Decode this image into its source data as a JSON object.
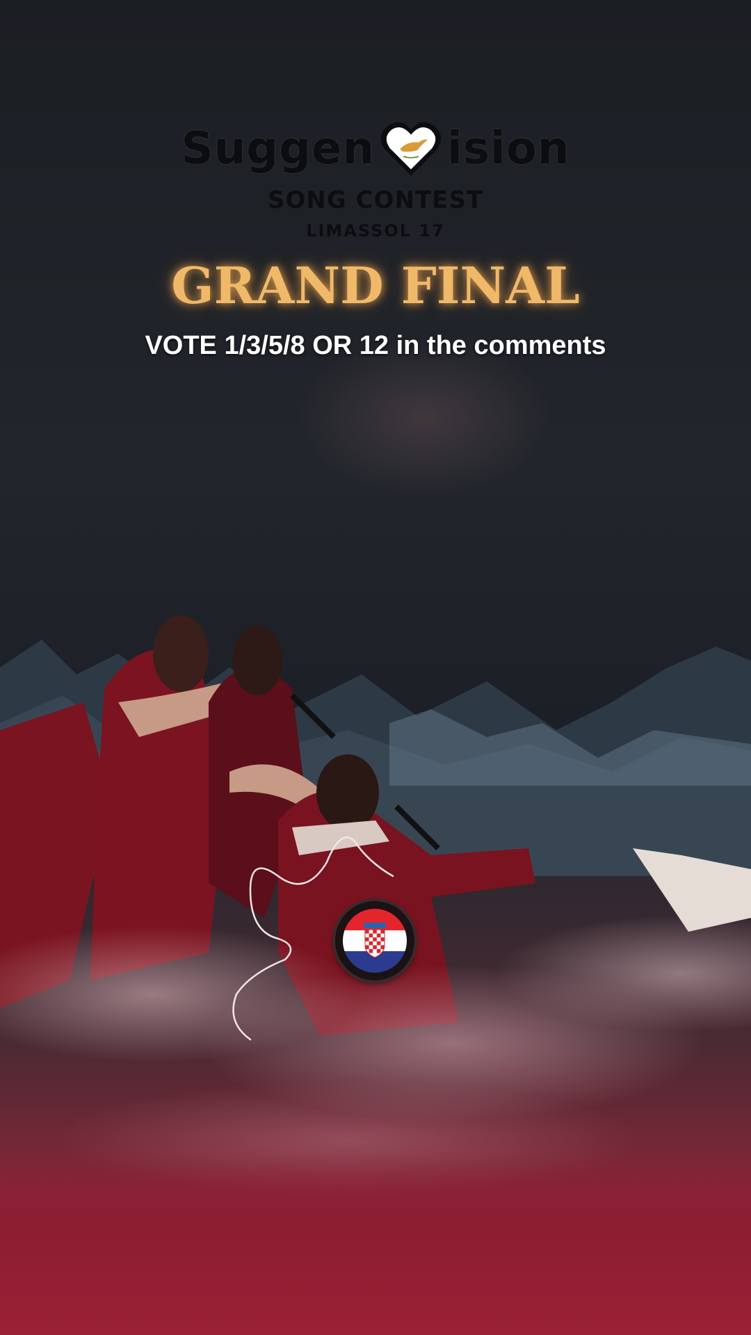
{
  "logo": {
    "word_left": "Suggen",
    "word_right": "ision",
    "subtitle": "SONG CONTEST",
    "edition": "LIMASSOL 17",
    "icon": "heart-with-cyprus-icon"
  },
  "headline": "GRAND FINAL",
  "instruction": "VOTE 1/3/5/8 OR 12 in the comments",
  "country_badge": {
    "icon": "croatia-flag-icon"
  },
  "colors": {
    "headline": "#f0b96a",
    "instruction": "#ffffff",
    "floor": "#8d1d32"
  }
}
